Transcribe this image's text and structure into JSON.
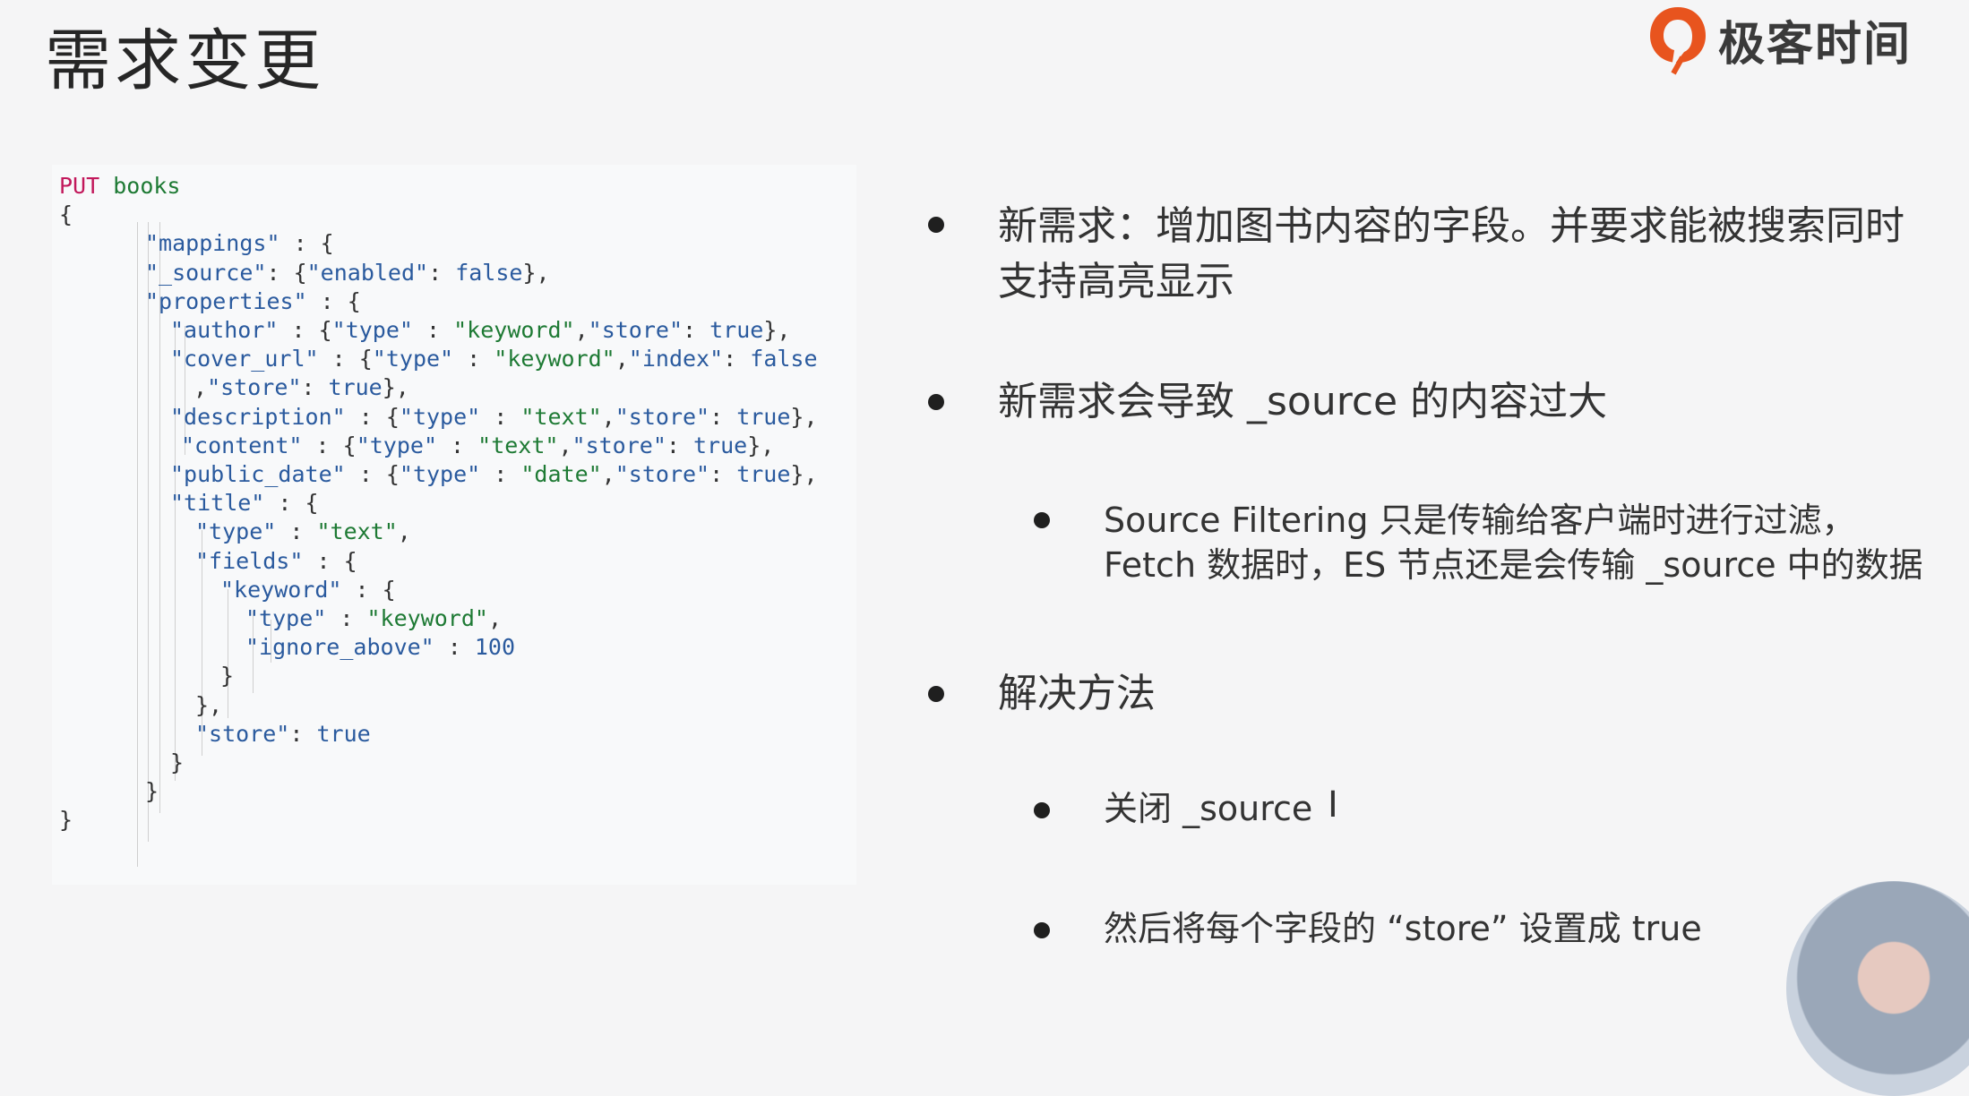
{
  "slide": {
    "title": "需求变更"
  },
  "logo": {
    "text": "极客时间",
    "brand_color": "#e8541e"
  },
  "code": {
    "lines": [
      [
        [
          "kw",
          "PUT"
        ],
        [
          "p",
          " "
        ],
        [
          "id",
          "books"
        ]
      ],
      [
        [
          "p",
          "{"
        ]
      ],
      [
        [
          "k",
          "\"mappings\""
        ],
        [
          "p",
          " : {"
        ]
      ],
      [
        [
          "k",
          "\"_source\""
        ],
        [
          "p",
          ": {"
        ],
        [
          "s",
          "\"enabled\""
        ],
        [
          "p",
          ": "
        ],
        [
          "b",
          "false"
        ],
        [
          "p",
          "},"
        ]
      ],
      [
        [
          "k",
          "\"properties\""
        ],
        [
          "p",
          " : {"
        ]
      ],
      [
        [
          "k",
          "\"author\""
        ],
        [
          "p",
          " : {"
        ],
        [
          "s",
          "\"type\""
        ],
        [
          "p",
          " : "
        ],
        [
          "id",
          "\"keyword\""
        ],
        [
          "p",
          ","
        ],
        [
          "s",
          "\"store\""
        ],
        [
          "p",
          ": "
        ],
        [
          "b",
          "true"
        ],
        [
          "p",
          "},"
        ]
      ],
      [
        [
          "k",
          "\"cover_url\""
        ],
        [
          "p",
          " : {"
        ],
        [
          "s",
          "\"type\""
        ],
        [
          "p",
          " : "
        ],
        [
          "id",
          "\"keyword\""
        ],
        [
          "p",
          ","
        ],
        [
          "s",
          "\"index\""
        ],
        [
          "p",
          ": "
        ],
        [
          "b",
          "false"
        ]
      ],
      [
        [
          "p",
          ","
        ],
        [
          "s",
          "\"store\""
        ],
        [
          "p",
          ": "
        ],
        [
          "b",
          "true"
        ],
        [
          "p",
          "},"
        ]
      ],
      [
        [
          "k",
          "\"description\""
        ],
        [
          "p",
          " : {"
        ],
        [
          "s",
          "\"type\""
        ],
        [
          "p",
          " : "
        ],
        [
          "id",
          "\"text\""
        ],
        [
          "p",
          ","
        ],
        [
          "s",
          "\"store\""
        ],
        [
          "p",
          ": "
        ],
        [
          "b",
          "true"
        ],
        [
          "p",
          "},"
        ]
      ],
      [
        [
          "k",
          "\"content\""
        ],
        [
          "p",
          " : {"
        ],
        [
          "s",
          "\"type\""
        ],
        [
          "p",
          " : "
        ],
        [
          "id",
          "\"text\""
        ],
        [
          "p",
          ","
        ],
        [
          "s",
          "\"store\""
        ],
        [
          "p",
          ": "
        ],
        [
          "b",
          "true"
        ],
        [
          "p",
          "},"
        ]
      ],
      [
        [
          "k",
          "\"public_date\""
        ],
        [
          "p",
          " : {"
        ],
        [
          "s",
          "\"type\""
        ],
        [
          "p",
          " : "
        ],
        [
          "id",
          "\"date\""
        ],
        [
          "p",
          ","
        ],
        [
          "s",
          "\"store\""
        ],
        [
          "p",
          ": "
        ],
        [
          "b",
          "true"
        ],
        [
          "p",
          "},"
        ]
      ],
      [
        [
          "k",
          "\"title\""
        ],
        [
          "p",
          " : {"
        ]
      ],
      [
        [
          "k",
          "\"type\""
        ],
        [
          "p",
          " : "
        ],
        [
          "id",
          "\"text\""
        ],
        [
          "p",
          ","
        ]
      ],
      [
        [
          "k",
          "\"fields\""
        ],
        [
          "p",
          " : {"
        ]
      ],
      [
        [
          "k",
          "\"keyword\""
        ],
        [
          "p",
          " : {"
        ]
      ],
      [
        [
          "k",
          "\"type\""
        ],
        [
          "p",
          " : "
        ],
        [
          "id",
          "\"keyword\""
        ],
        [
          "p",
          ","
        ]
      ],
      [
        [
          "k",
          "\"ignore_above\""
        ],
        [
          "p",
          " : "
        ],
        [
          "n",
          "100"
        ]
      ],
      [
        [
          "p",
          "}"
        ]
      ],
      [
        [
          "p",
          "},"
        ]
      ],
      [
        [
          "k",
          "\"store\""
        ],
        [
          "p",
          ": "
        ],
        [
          "b",
          "true"
        ]
      ],
      [
        [
          "p",
          "}"
        ]
      ],
      [
        [
          "p",
          "}"
        ]
      ],
      [
        [
          "p",
          "}"
        ]
      ]
    ]
  },
  "bullets": {
    "b1_line1": "新需求：增加图书内容的字段。并要求能被搜索同时",
    "b1_line2": "支持高亮显示",
    "b2": "新需求会导致 _source 的内容过大",
    "b2_sub_line1": "Source Filtering 只是传输给客户端时进行过滤，",
    "b2_sub_line2": "Fetch 数据时，ES 节点还是会传输 _source 中的数据",
    "b3": "解决方法",
    "b3_sub1": "关闭 _source",
    "b3_sub2": "然后将每个字段的 “store” 设置成 true"
  },
  "cursor": "I"
}
